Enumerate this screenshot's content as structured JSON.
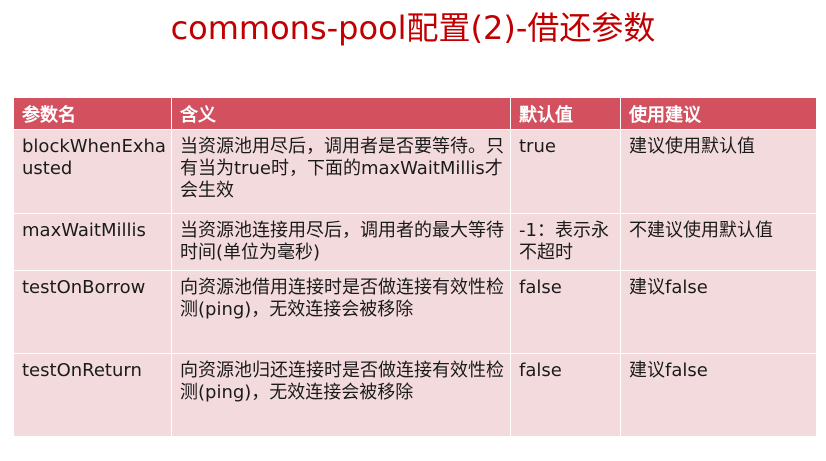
{
  "title": "commons-pool配置(2)-借还参数",
  "table": {
    "headers": [
      "参数名",
      "含义",
      "默认值",
      "使用建议"
    ],
    "rows": [
      {
        "param": "blockWhenExhausted",
        "meaning": "当资源池用尽后，调用者是否要等待。只有当为true时，下面的maxWaitMillis才会生效",
        "default": "true",
        "advice": "建议使用默认值"
      },
      {
        "param": "maxWaitMillis",
        "meaning": "当资源池连接用尽后，调用者的最大等待时间(单位为毫秒)",
        "default": "-1：表示永不超时",
        "advice": "不建议使用默认值"
      },
      {
        "param": "testOnBorrow",
        "meaning": "向资源池借用连接时是否做连接有效性检测(ping)，无效连接会被移除",
        "default": "false",
        "advice": "建议false"
      },
      {
        "param": "testOnReturn",
        "meaning": "向资源池归还连接时是否做连接有效性检测(ping)，无效连接会被移除",
        "default": "false",
        "advice": "建议false"
      }
    ]
  }
}
